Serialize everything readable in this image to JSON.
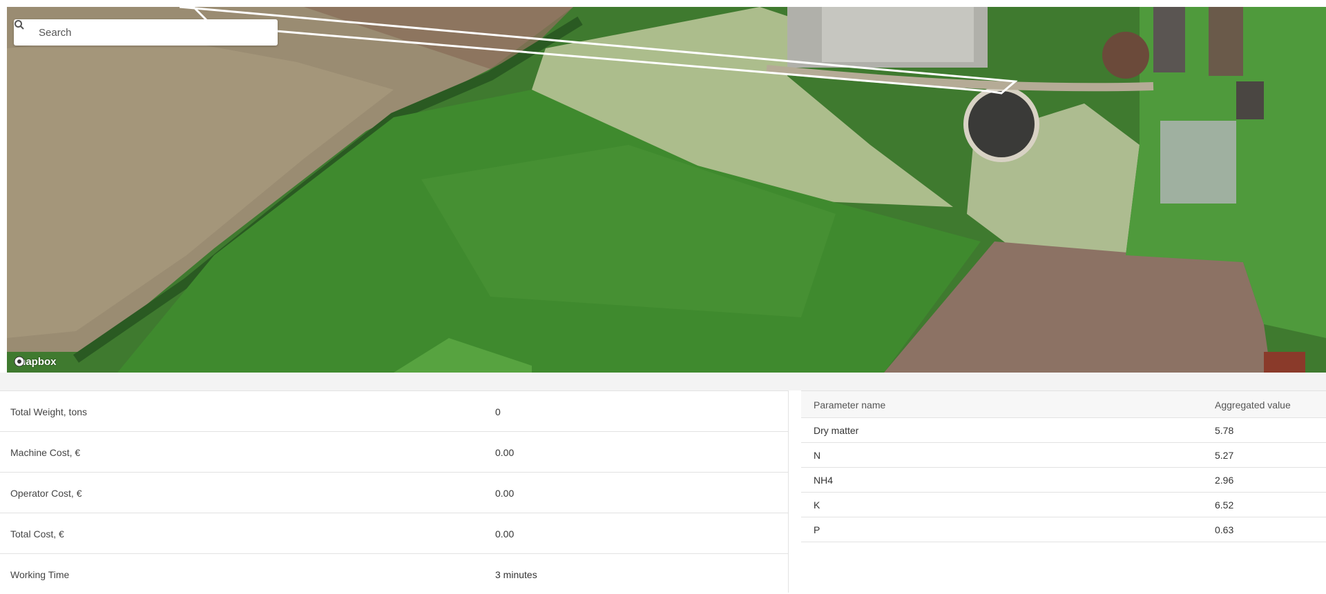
{
  "map": {
    "search_placeholder": "Search",
    "attribution": "mapbox"
  },
  "summary": {
    "rows": [
      {
        "label": "Total Weight, tons",
        "value": "0"
      },
      {
        "label": "Machine Cost, €",
        "value": "0.00"
      },
      {
        "label": "Operator Cost, €",
        "value": "0.00"
      },
      {
        "label": "Total Cost, €",
        "value": "0.00"
      },
      {
        "label": "Working Time",
        "value": "3 minutes"
      }
    ]
  },
  "parameters": {
    "headers": [
      "Parameter name",
      "Aggregated value"
    ],
    "rows": [
      {
        "name": "Dry matter",
        "value": "5.78"
      },
      {
        "name": "N",
        "value": "5.27"
      },
      {
        "name": "NH4",
        "value": "2.96"
      },
      {
        "name": "K",
        "value": "6.52"
      },
      {
        "name": "P",
        "value": "0.63"
      }
    ]
  }
}
